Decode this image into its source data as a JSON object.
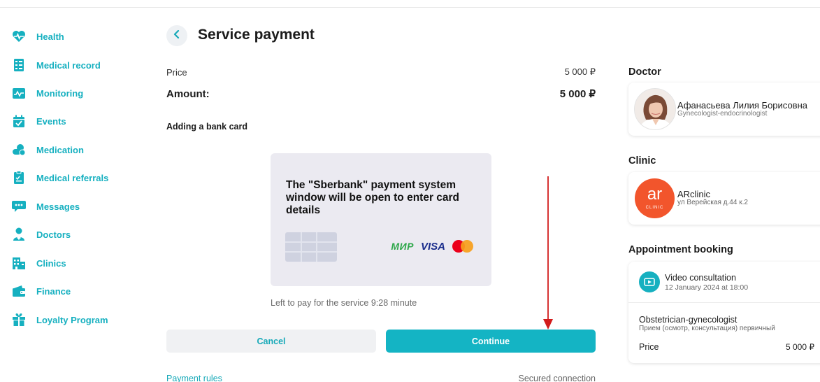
{
  "sidebar": {
    "items": [
      {
        "label": "Health",
        "icon": "heart-pulse-icon"
      },
      {
        "label": "Medical record",
        "icon": "medical-record-icon"
      },
      {
        "label": "Monitoring",
        "icon": "monitoring-icon"
      },
      {
        "label": "Events",
        "icon": "calendar-check-icon"
      },
      {
        "label": "Medication",
        "icon": "pills-icon"
      },
      {
        "label": "Medical referrals",
        "icon": "clipboard-icon"
      },
      {
        "label": "Messages",
        "icon": "chat-icon"
      },
      {
        "label": "Doctors",
        "icon": "doctor-icon"
      },
      {
        "label": "Clinics",
        "icon": "building-icon"
      },
      {
        "label": "Finance",
        "icon": "wallet-icon"
      },
      {
        "label": "Loyalty Program",
        "icon": "gift-icon"
      }
    ]
  },
  "main": {
    "title": "Service payment",
    "price_label": "Price",
    "price_value": "5 000 ₽",
    "amount_label": "Amount:",
    "amount_value": "5 000 ₽",
    "add_card_label": "Adding a bank card",
    "card_message": "The \"Sberbank\" payment system window will be open to enter card details",
    "card_logos": {
      "mir": "МИР",
      "visa": "VISA"
    },
    "timer_text": "Left to pay for the service 9:28 minute",
    "cancel_label": "Cancel",
    "continue_label": "Continue",
    "payment_rules_label": "Payment rules",
    "secured_label": "Secured connection"
  },
  "doctor": {
    "section_title": "Doctor",
    "name": "Афанасьева Лилия Борисовна",
    "specialty": "Gynecologist-endocrinologist"
  },
  "clinic": {
    "section_title": "Clinic",
    "logo_text": "ar",
    "logo_sub": "CLINIC",
    "name": "ARclinic",
    "address": "ул Верейская д.44 к.2"
  },
  "booking": {
    "section_title": "Appointment booking",
    "type": "Video consultation",
    "datetime": "12 January 2024 at 18:00",
    "specialty": "Obstetrician-gynecologist",
    "service": "Прием (осмотр, консультация) первичный",
    "price_label": "Price",
    "price_value": "5 000 ₽"
  },
  "colors": {
    "accent": "#14b4c4",
    "arrow": "#d21c1c",
    "clinic_brand": "#f2552c"
  }
}
